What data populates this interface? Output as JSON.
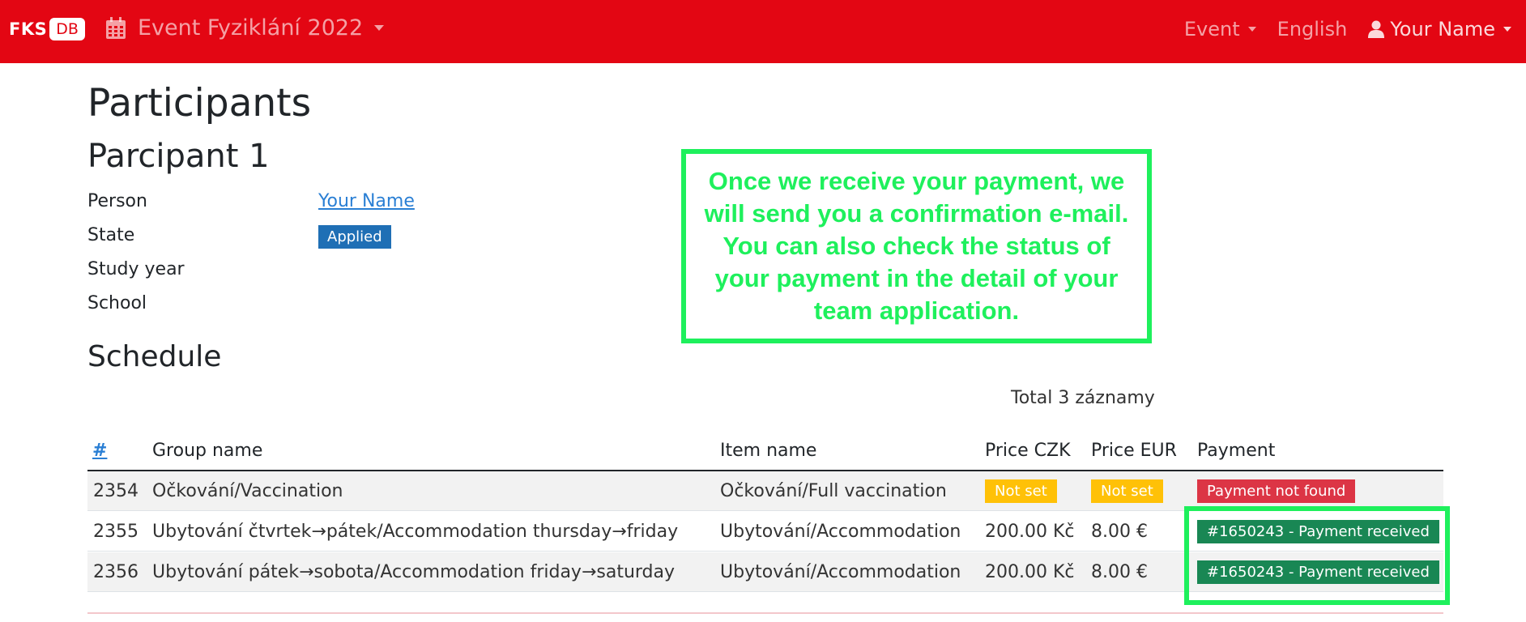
{
  "navbar": {
    "brand_fks": "FKS",
    "brand_db": "DB",
    "event_title": "Event Fyziklání 2022",
    "event_menu": "Event",
    "language": "English",
    "user": "Your Name"
  },
  "page": {
    "title": "Participants",
    "participant_heading": "Parcipant 1",
    "details": [
      {
        "label": "Person",
        "value": "Your Name"
      },
      {
        "label": "State",
        "value": "Applied"
      },
      {
        "label": "Study year",
        "value": ""
      },
      {
        "label": "School",
        "value": ""
      }
    ]
  },
  "schedule": {
    "heading": "Schedule",
    "total": "Total 3 záznamy",
    "columns": [
      "#",
      "Group name",
      "Item name",
      "Price CZK",
      "Price EUR",
      "Payment"
    ],
    "rows": [
      {
        "id": "2354",
        "group": "Očkování/Vaccination",
        "item": "Očkování/Full vaccination",
        "czk": "Not set",
        "eur": "Not set",
        "payment": "Payment not found"
      },
      {
        "id": "2355",
        "group": "Ubytování čtvrtek→pátek/Accommodation thursday→friday",
        "item": "Ubytování/Accommodation",
        "czk": "200.00 Kč",
        "eur": "8.00 €",
        "payment": "#1650243 - Payment received"
      },
      {
        "id": "2356",
        "group": "Ubytování pátek→sobota/Accommodation friday→saturday",
        "item": "Ubytování/Accommodation",
        "czk": "200.00 Kč",
        "eur": "8.00 €",
        "payment": "#1650243 - Payment received"
      }
    ]
  },
  "annotation": {
    "text": "Once we receive your payment, we will send you a confirmation e-mail. You can also check the status of your payment in the detail of your team application."
  },
  "colors": {
    "navbar": "#e30613",
    "annotation": "#1ef05c",
    "badge_applied": "#1f6fb5",
    "badge_warning": "#ffc107",
    "badge_danger": "#dc3545",
    "badge_success": "#198754"
  },
  "icons": {
    "event": "calendar-icon",
    "user": "user-icon",
    "dropdown": "caret-down-icon"
  }
}
